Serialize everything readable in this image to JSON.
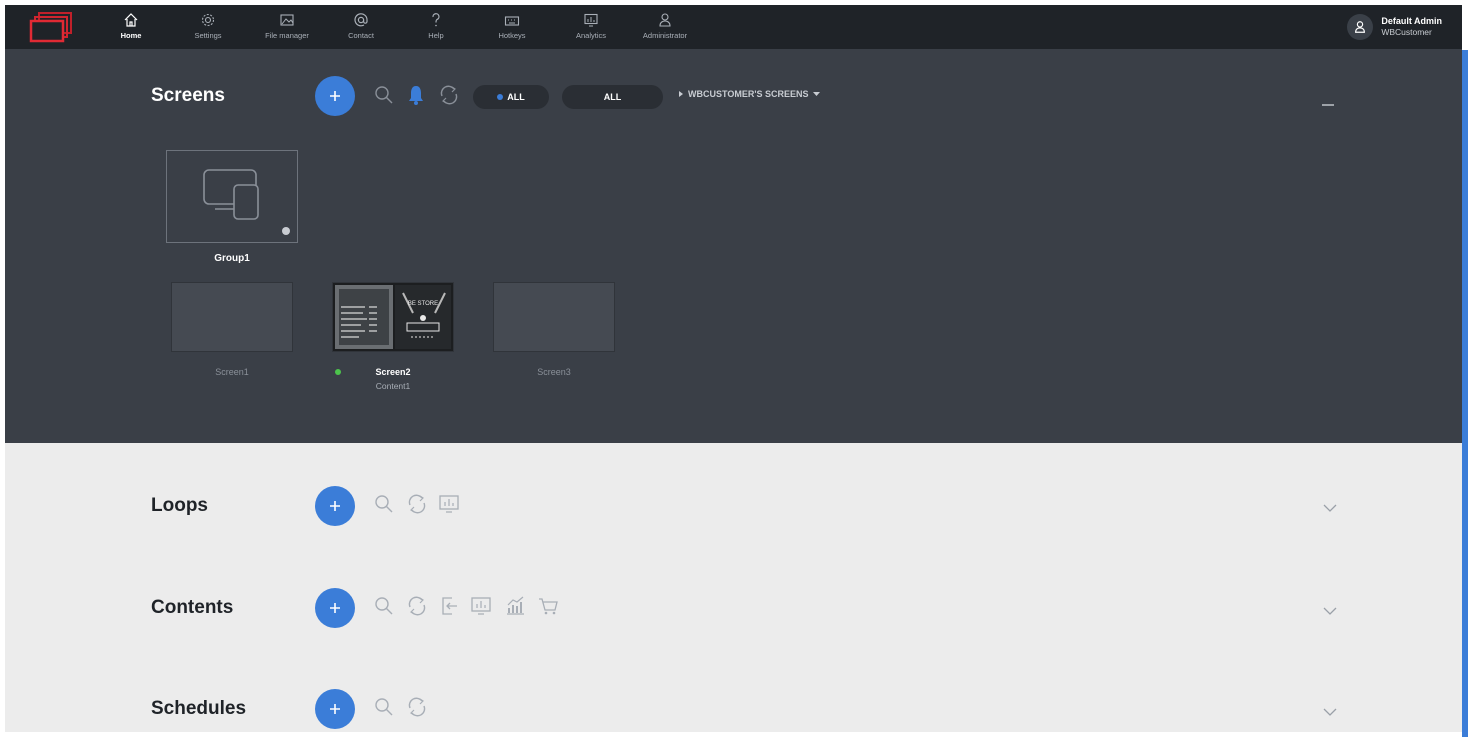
{
  "nav": {
    "items": [
      {
        "label": "Home",
        "icon": "home-icon"
      },
      {
        "label": "Settings",
        "icon": "gear-icon"
      },
      {
        "label": "File manager",
        "icon": "folder-image-icon"
      },
      {
        "label": "Contact",
        "icon": "at-icon"
      },
      {
        "label": "Help",
        "icon": "question-icon"
      },
      {
        "label": "Hotkeys",
        "icon": "keyboard-icon"
      },
      {
        "label": "Analytics",
        "icon": "monitor-chart-icon"
      },
      {
        "label": "Administrator",
        "icon": "person-icon"
      }
    ],
    "active": "Home"
  },
  "user": {
    "name": "Default Admin",
    "org": "WBCustomer"
  },
  "screens": {
    "title": "Screens",
    "filter_status": "ALL",
    "filter_type": "ALL",
    "breadcrumb": "WBCUSTOMER'S SCREENS",
    "group": {
      "name": "Group1"
    },
    "items": [
      {
        "name": "Screen1",
        "online": false,
        "content": ""
      },
      {
        "name": "Screen2",
        "online": true,
        "content": "Content1"
      },
      {
        "name": "Screen3",
        "online": false,
        "content": ""
      }
    ]
  },
  "loops": {
    "title": "Loops"
  },
  "contents": {
    "title": "Contents"
  },
  "schedules": {
    "title": "Schedules"
  },
  "colors": {
    "accent": "#3b7dd8",
    "topbar": "#1f2328",
    "dark_panel": "#3a3f47",
    "online": "#4cc44c"
  }
}
